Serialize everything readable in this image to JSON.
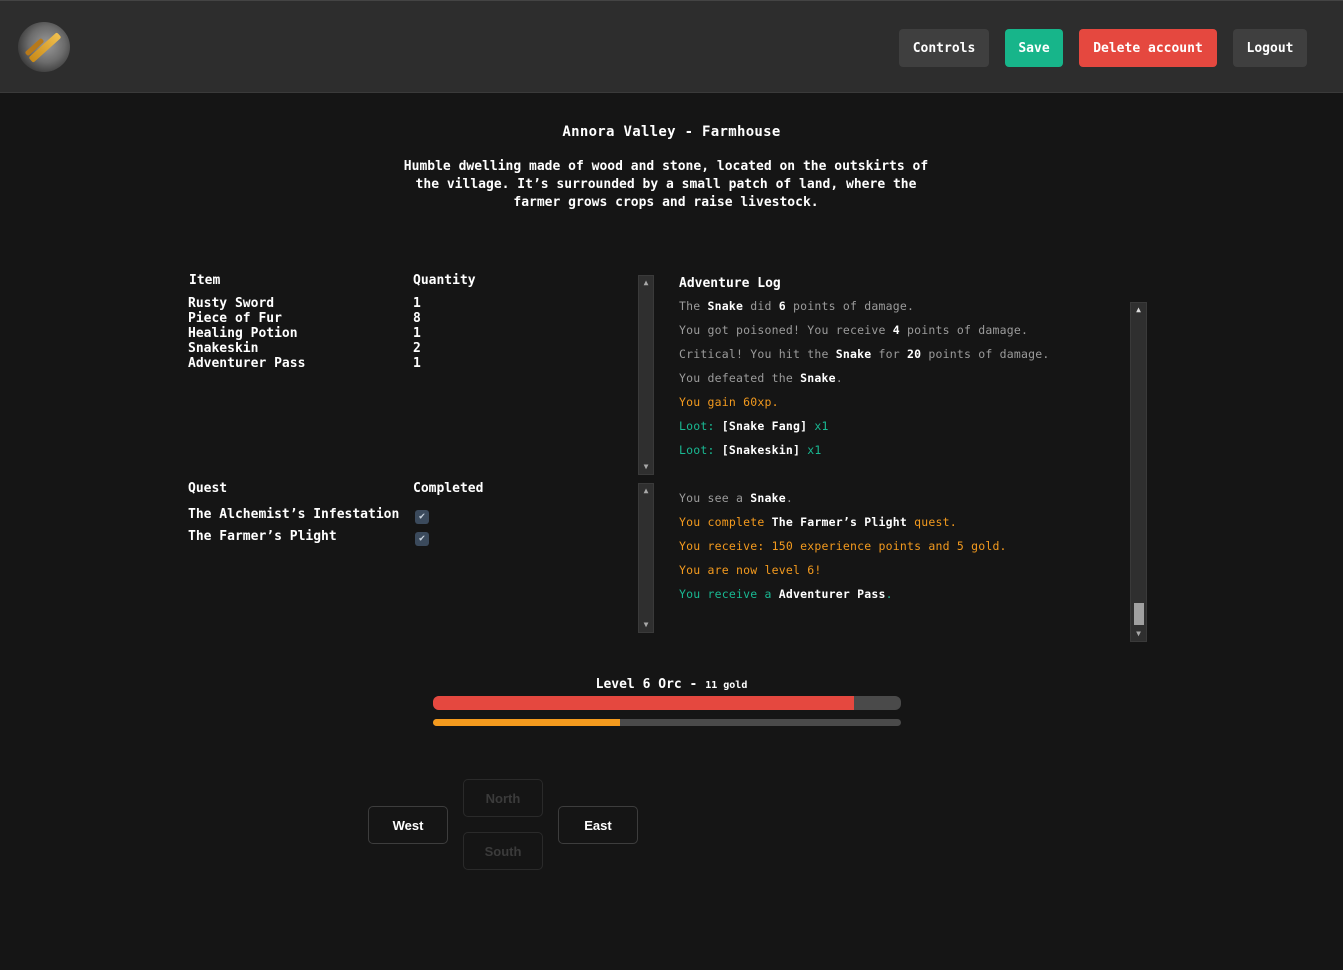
{
  "header": {
    "logo_icon": "sword-logo-icon",
    "buttons": {
      "controls": "Controls",
      "save": "Save",
      "delete": "Delete account",
      "logout": "Logout"
    }
  },
  "location": {
    "title": "Annora Valley - Farmhouse",
    "description": "Humble dwelling made of wood and stone, located on the outskirts of the village. It’s surrounded by a small patch of land, where the farmer grows crops and raise livestock."
  },
  "inventory": {
    "headers": {
      "item": "Item",
      "quantity": "Quantity"
    },
    "rows": [
      {
        "name": "Rusty Sword",
        "qty": "1"
      },
      {
        "name": "Piece of Fur",
        "qty": "8"
      },
      {
        "name": "Healing Potion",
        "qty": "1"
      },
      {
        "name": "Snakeskin",
        "qty": "2"
      },
      {
        "name": "Adventurer Pass",
        "qty": "1"
      }
    ]
  },
  "quests": {
    "headers": {
      "quest": "Quest",
      "completed": "Completed"
    },
    "rows": [
      {
        "name": "The Alchemist’s Infestation",
        "completed": true
      },
      {
        "name": "The Farmer’s Plight",
        "completed": true
      }
    ]
  },
  "log": {
    "title": "Adventure Log",
    "combat": [
      [
        "The ",
        "Snake",
        " did ",
        "6",
        " points of damage."
      ],
      [
        "You got poisoned! You receive ",
        "4",
        " points of damage."
      ],
      [
        "Critical! You hit the ",
        "Snake",
        " for ",
        "20",
        " points of damage."
      ],
      [
        "You defeated the ",
        "Snake",
        "."
      ],
      [
        "You gain 60xp."
      ],
      [
        "Loot: ",
        "[Snake Fang]",
        " x1"
      ],
      [
        "Loot: ",
        "[Snakeskin]",
        " x1"
      ]
    ],
    "events": [
      [
        "You see a ",
        "Snake",
        "."
      ],
      [
        "You complete ",
        "The Farmer’s Plight",
        " quest."
      ],
      [
        "You receive: 150 experience points and 5 gold."
      ],
      [
        "You are now level 6!"
      ],
      [
        "You receive a ",
        "Adventurer Pass",
        "."
      ]
    ]
  },
  "character": {
    "summary": "Level 6 Orc - ",
    "gold": "11 gold",
    "health_fraction": 0.9,
    "health_color": "#e5483f",
    "xp_fraction": 0.4,
    "xp_color": "#f39a1e"
  },
  "movement": {
    "north": "North",
    "south": "South",
    "west": "West",
    "east": "East"
  },
  "colors": {
    "background": "#151515",
    "topbar": "#2d2d2d",
    "save": "#17b58a",
    "delete": "#e5483f",
    "orange": "#f39a1e",
    "green": "#19b892"
  }
}
